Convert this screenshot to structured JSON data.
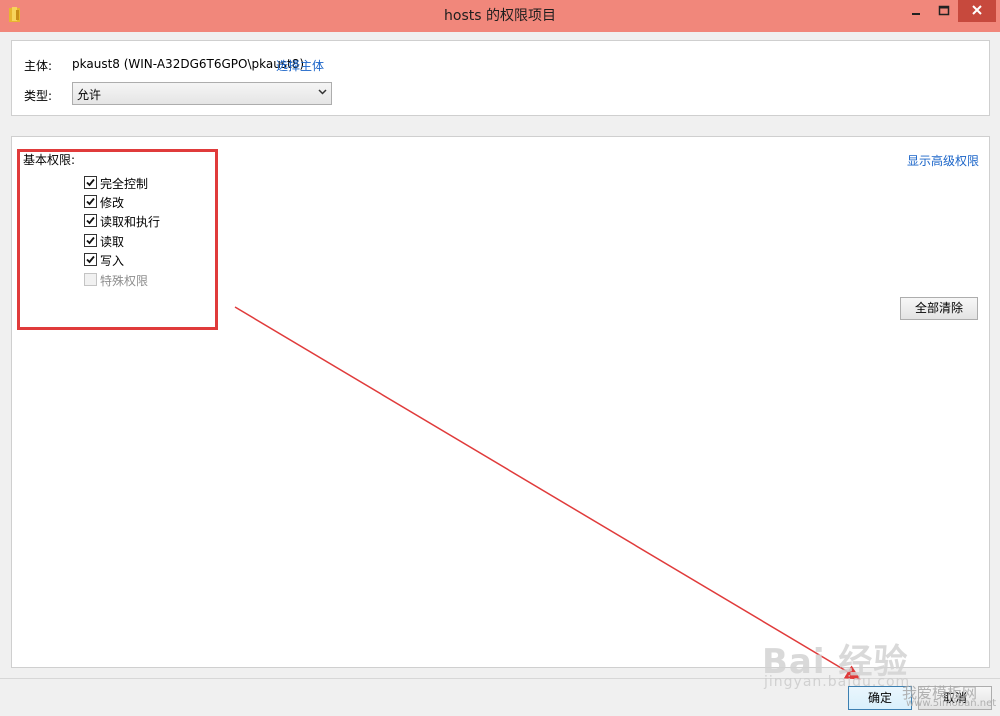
{
  "window": {
    "title": "hosts 的权限项目",
    "app_icon": "folder-icon",
    "title_bar_color": "#f1877b"
  },
  "principal": {
    "label": "主体:",
    "value": "pkaust8 (WIN-A32DG6T6GPO\\pkaust8)",
    "select_link": "选择主体"
  },
  "type": {
    "label": "类型:",
    "selected": "允许"
  },
  "permissions": {
    "title": "基本权限:",
    "show_advanced_link": "显示高级权限",
    "items": [
      {
        "label": "完全控制",
        "checked": true,
        "enabled": true
      },
      {
        "label": "修改",
        "checked": true,
        "enabled": true
      },
      {
        "label": "读取和执行",
        "checked": true,
        "enabled": true
      },
      {
        "label": "读取",
        "checked": true,
        "enabled": true
      },
      {
        "label": "写入",
        "checked": true,
        "enabled": true
      },
      {
        "label": "特殊权限",
        "checked": false,
        "enabled": false
      }
    ],
    "clear_all_button": "全部清除"
  },
  "footer": {
    "ok_button": "确定",
    "cancel_button": "取消"
  },
  "annotations": {
    "color": "#e03b3b"
  },
  "watermark": {
    "main": "Bai 经验",
    "sub": "jingyan.baidu.com",
    "site": "我爱模板网",
    "url": "www.5imoban.net"
  }
}
